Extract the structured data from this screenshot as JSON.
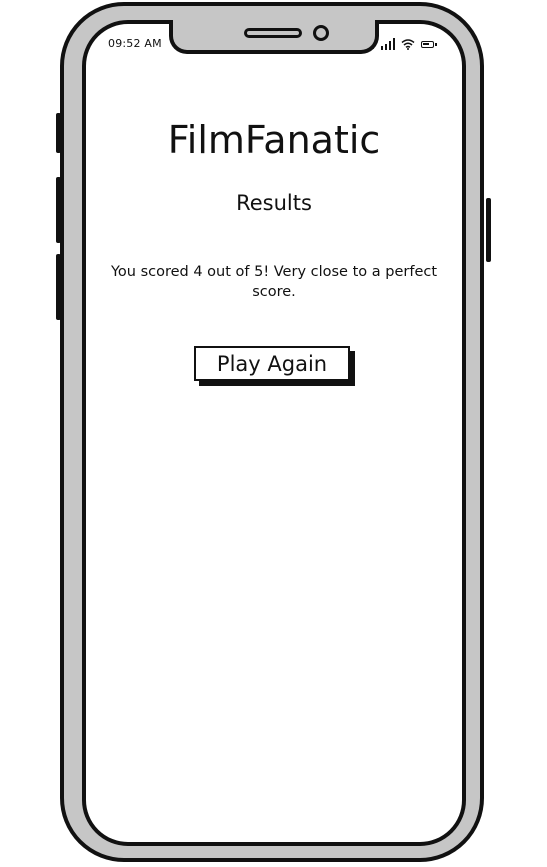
{
  "status_bar": {
    "time": "09:52 AM",
    "icons": [
      "signal-icon",
      "wifi-icon",
      "battery-icon"
    ]
  },
  "app": {
    "title": "FilmFanatic"
  },
  "results": {
    "heading": "Results",
    "message": "You scored 4 out of 5! Very close to a perfect score.",
    "play_again_label": "Play Again"
  }
}
